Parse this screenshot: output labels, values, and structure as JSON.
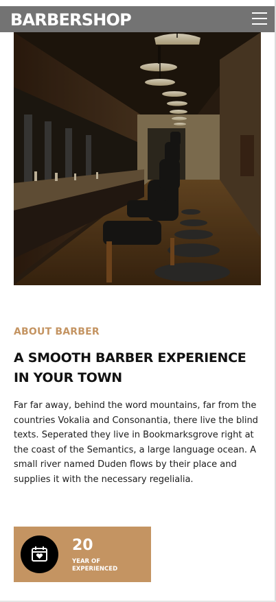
{
  "header": {
    "brand": "BARBERSHOP",
    "menu_icon": "hamburger-menu-icon"
  },
  "hero": {
    "image_alt": "Barbershop interior with barber chairs and mirrors"
  },
  "about": {
    "tag": "ABOUT BARBER",
    "heading": "A SMOOTH BARBER EXPERIENCE IN YOUR TOWN",
    "paragraph": "Far far away, behind the word mountains, far from the countries Vokalia and Consonantia, there live the blind texts. Seperated they live in Bookmarksgrove right at the coast of the Semantics, a large language ocean. A small river named Duden flows by their place and supplies it with the necessary regelialia."
  },
  "stat": {
    "icon": "calendar-heart-icon",
    "number": "20",
    "label": "YEAR OF EXPERIENCED"
  },
  "colors": {
    "accent": "#c49462",
    "navbar_overlay": "rgba(0,0,0,0.55)",
    "text": "#111111"
  }
}
